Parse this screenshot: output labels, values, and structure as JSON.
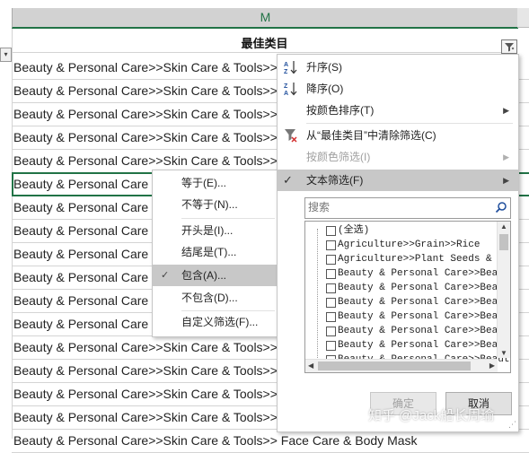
{
  "column_letter": "M",
  "header": {
    "title": "最佳类目"
  },
  "rows": [
    "Beauty & Personal Care>>Skin Care & Tools>>",
    "Beauty & Personal Care>>Skin Care & Tools>>",
    "Beauty & Personal Care>>Skin Care & Tools>>",
    "Beauty & Personal Care>>Skin Care & Tools>>",
    "Beauty & Personal Care>>Skin Care & Tools>>",
    "Beauty & Personal Care",
    "Beauty & Personal Care",
    "Beauty & Personal Care",
    "Beauty & Personal Care",
    "Beauty & Personal Care",
    "Beauty & Personal Care",
    "Beauty & Personal Care",
    "Beauty & Personal Care>>Skin Care & Tools>>",
    "Beauty & Personal Care>>Skin Care & Tools>>",
    "Beauty & Personal Care>>Skin Care & Tools>>",
    "Beauty & Personal Care>>Skin Care & Tools>>",
    "Beauty & Personal Care>>Skin Care & Tools>> Face Care & Body Mask"
  ],
  "filter_menu": {
    "sort_asc": "升序(S)",
    "sort_desc": "降序(O)",
    "sort_by_color": "按颜色排序(T)",
    "clear_filter": "从“最佳类目”中清除筛选(C)",
    "filter_by_color": "按颜色筛选(I)",
    "text_filters": "文本筛选(F)",
    "search_placeholder": "搜索",
    "list_items": [
      "(全选)",
      "Agriculture>>Grain>>Rice",
      "Agriculture>>Plant Seeds & Bulbs",
      "Beauty & Personal Care>>Beauty",
      "Beauty & Personal Care>>Beauty",
      "Beauty & Personal Care>>Beauty",
      "Beauty & Personal Care>>Beauty",
      "Beauty & Personal Care>>Beauty",
      "Beauty & Personal Care>>Beauty",
      "Beauty & Personal Care>>Beauty"
    ],
    "ok_button": "确定",
    "cancel_button": "取消"
  },
  "text_filter_submenu": {
    "items": [
      "等于(E)...",
      "不等于(N)...",
      "开头是(I)...",
      "结尾是(T)...",
      "包含(A)...",
      "不包含(D)...",
      "自定义筛选(F)..."
    ]
  },
  "watermark": "知乎 @Jack船长周瑜",
  "colors": {
    "accent": "#217346",
    "highlight": "#c8c8c8",
    "header_bg": "#d2d2d2"
  }
}
